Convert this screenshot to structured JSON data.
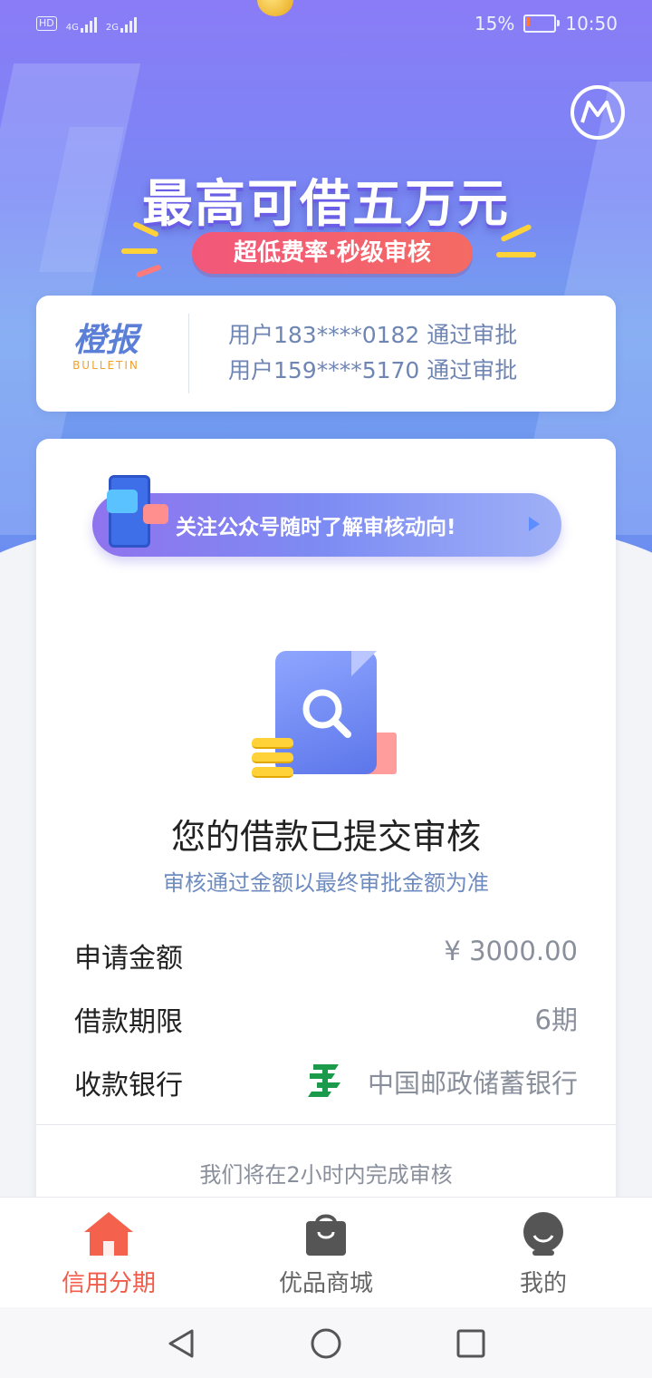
{
  "status_bar": {
    "network_badge": "HD",
    "sig1_label": "4G",
    "sig2_label": "2G",
    "battery_percent": "15%",
    "battery_level": 0.15,
    "time": "10:50",
    "battery_color": "#ff7a3d"
  },
  "hero": {
    "headline": "最高可借五万元",
    "subline": "超低费率·秒级审核"
  },
  "bulletin": {
    "brand_cn": "橙报",
    "brand_en": "BULLETIN",
    "lines": [
      "用户183****0182 通过审批",
      "用户159****5170 通过审批"
    ]
  },
  "promo": {
    "text": "关注公众号随时了解审核动向!"
  },
  "status_card": {
    "title": "您的借款已提交审核",
    "subtitle": "审核通过金额以最终审批金额为准",
    "rows": [
      {
        "label": "申请金额",
        "value": "¥ 3000.00"
      },
      {
        "label": "借款期限",
        "value": "6期"
      },
      {
        "label": "收款银行",
        "value": "中国邮政储蓄银行"
      }
    ],
    "note": "我们将在2小时内完成审核"
  },
  "tabs": [
    {
      "label": "信用分期",
      "icon": "home-icon",
      "active": true
    },
    {
      "label": "优品商城",
      "icon": "shopping-bag-icon",
      "active": false
    },
    {
      "label": "我的",
      "icon": "profile-icon",
      "active": false
    }
  ],
  "colors": {
    "accent": "#f25c4a",
    "hero_start": "#8a7cf6",
    "hero_end": "#6c8ef0",
    "subline": "#f2577a",
    "postal_green": "#1a9a4a"
  }
}
